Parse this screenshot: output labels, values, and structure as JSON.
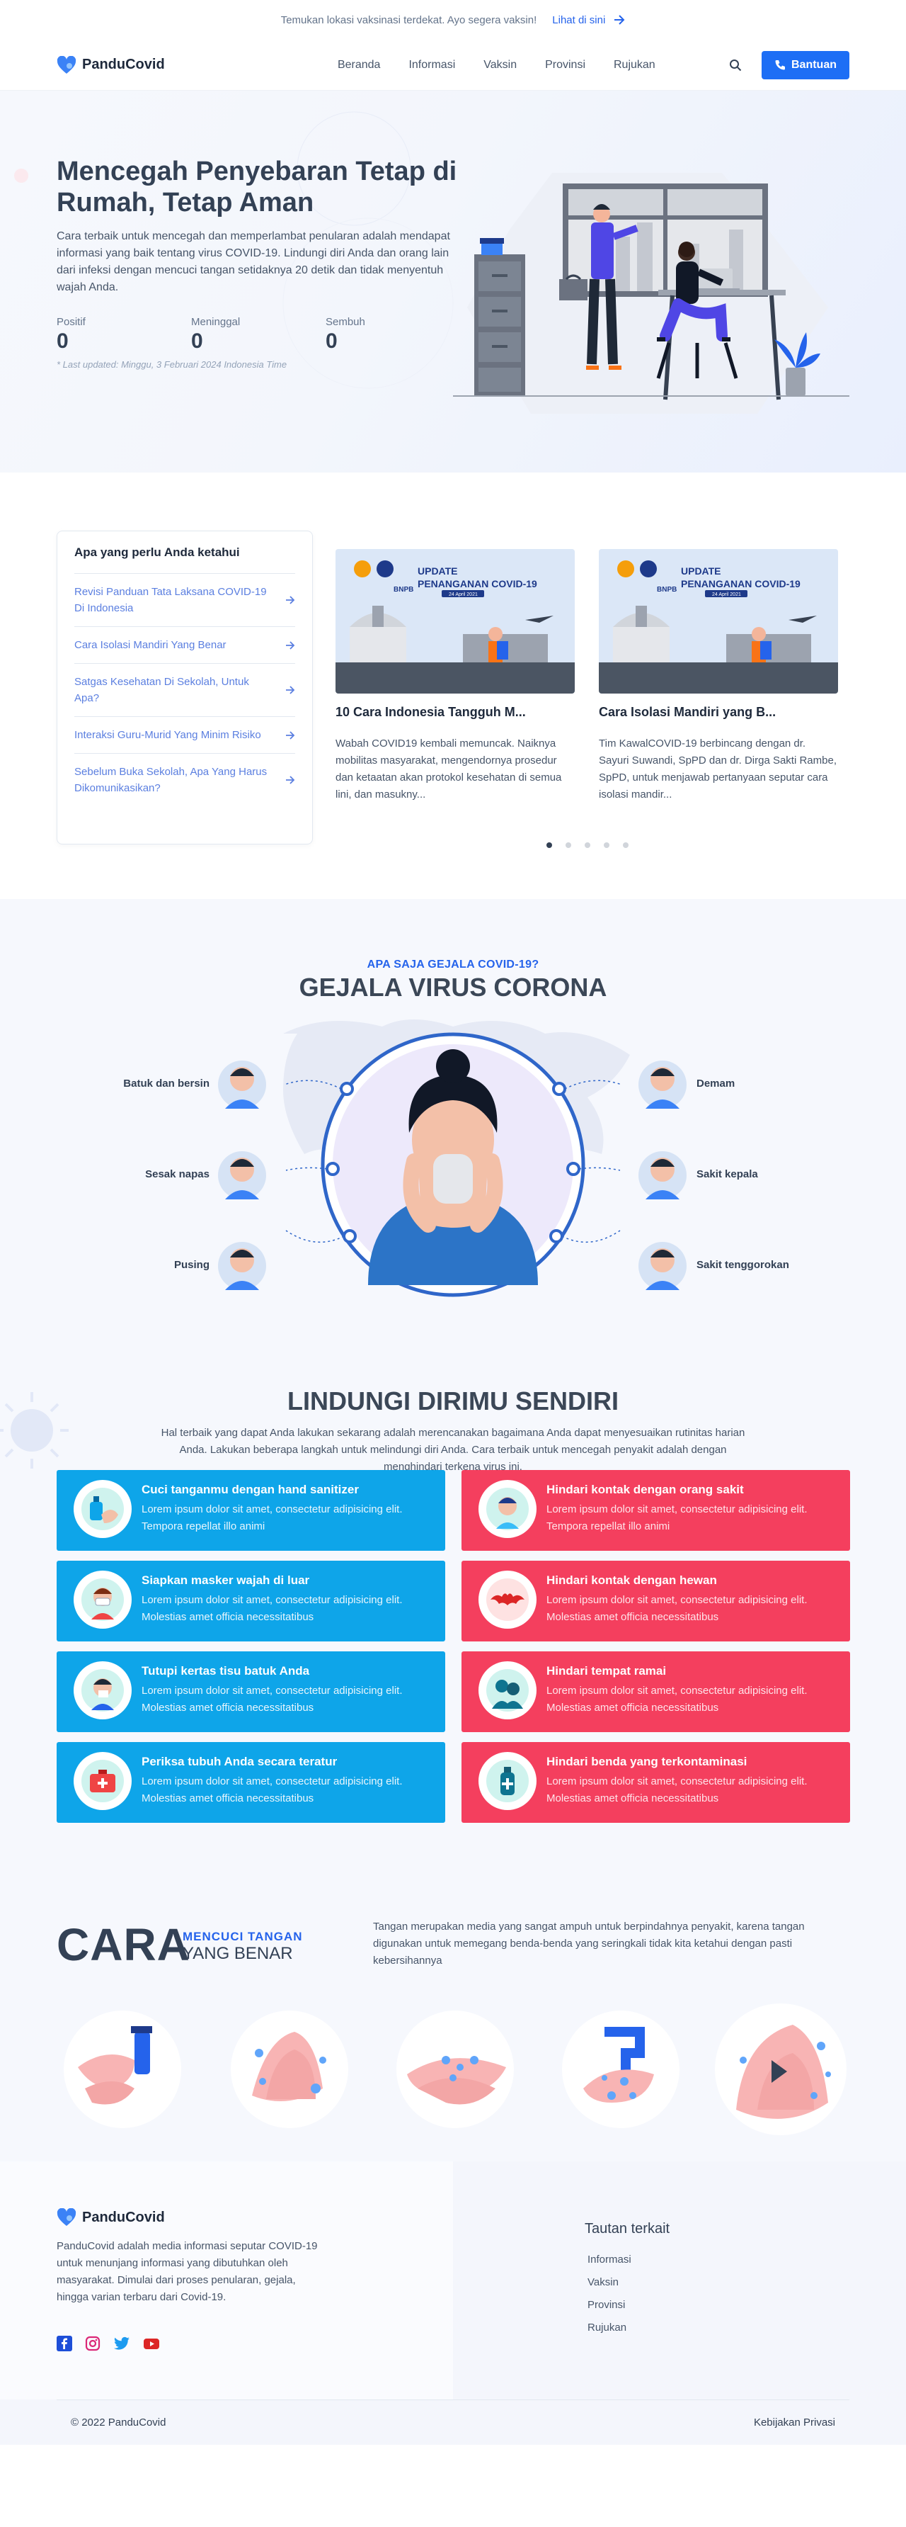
{
  "announcement": {
    "text": "Temukan lokasi vaksinasi terdekat. Ayo segera vaksin!",
    "link": "Lihat di sini"
  },
  "nav": {
    "brand": "PanduCovid",
    "links": [
      "Beranda",
      "Informasi",
      "Vaksin",
      "Provinsi",
      "Rujukan"
    ],
    "help_label": "Bantuan"
  },
  "hero": {
    "title": "Mencegah Penyebaran Tetap di Rumah, Tetap Aman",
    "lead": "Cara terbaik untuk mencegah dan memperlambat penularan adalah mendapat informasi yang baik tentang virus COVID-19. Lindungi diri Anda dan orang lain dari infeksi dengan mencuci tangan setidaknya 20 detik dan tidak menyentuh wajah Anda.",
    "stats": [
      {
        "label": "Positif",
        "value": "0"
      },
      {
        "label": "Meninggal",
        "value": "0"
      },
      {
        "label": "Sembuh",
        "value": "0"
      }
    ],
    "updated": "* Last updated: Minggu, 3 Februari 2024 Indonesia Time"
  },
  "faq": {
    "title": "Apa yang perlu Anda ketahui",
    "items": [
      "Revisi Panduan Tata Laksana COVID-19 Di Indonesia",
      "Cara Isolasi Mandiri Yang Benar",
      "Satgas Kesehatan Di Sekolah, Untuk Apa?",
      "Interaksi Guru-Murid Yang Minim Risiko",
      "Sebelum Buka Sekolah, Apa Yang Harus Dikomunikasikan?"
    ]
  },
  "news": [
    {
      "banner_title": "UPDATE PENANGANAN COVID-19",
      "banner_date": "24 April 2021",
      "agency": "BNPB",
      "title": "10 Cara Indonesia Tangguh M...",
      "body": "Wabah COVID19 kembali memuncak. Naiknya mobilitas masyarakat, mengendornya prosedur dan ketaatan akan protokol kesehatan di semua lini, dan masukny..."
    },
    {
      "banner_title": "UPDATE PENANGANAN COVID-19",
      "banner_date": "24 April 2021",
      "agency": "BNPB",
      "title": "Cara Isolasi Mandiri yang B...",
      "body": "Tim KawalCOVID-19 berbincang dengan dr. Sayuri Suwandi, SpPD dan dr. Dirga Sakti Rambe, SpPD, untuk menjawab pertanyaan seputar cara isolasi mandir..."
    }
  ],
  "carousel": {
    "active_index": 0,
    "count": 5
  },
  "gejala": {
    "subtitle": "APA SAJA GEJALA COVID-19?",
    "title": "GEJALA VIRUS CORONA",
    "left": [
      "Batuk dan bersin",
      "Sesak napas",
      "Pusing"
    ],
    "right": [
      "Demam",
      "Sakit kepala",
      "Sakit tenggorokan"
    ]
  },
  "lindungi": {
    "title": "LINDUNGI DIRIMU SENDIRI",
    "desc": "Hal terbaik yang dapat Anda lakukan sekarang adalah merencanakan bagaimana Anda dapat menyesuaikan rutinitas harian Anda. Lakukan beberapa langkah untuk melindungi diri Anda. Cara terbaik untuk mencegah penyakit adalah dengan menghindari terkena virus ini.",
    "dos": [
      {
        "title": "Cuci tanganmu dengan hand sanitizer",
        "body": "Lorem ipsum dolor sit amet, consectetur adipisicing elit. Tempora repellat illo animi",
        "icon": "hand-sanitizer-icon"
      },
      {
        "title": "Siapkan masker wajah di luar",
        "body": "Lorem ipsum dolor sit amet, consectetur adipisicing elit. Molestias amet officia necessitatibus",
        "icon": "face-mask-icon"
      },
      {
        "title": "Tutupi kertas tisu batuk Anda",
        "body": "Lorem ipsum dolor sit amet, consectetur adipisicing elit. Molestias amet officia necessitatibus",
        "icon": "tissue-cough-icon"
      },
      {
        "title": "Periksa tubuh Anda secara teratur",
        "body": "Lorem ipsum dolor sit amet, consectetur adipisicing elit. Molestias amet officia necessitatibus",
        "icon": "first-aid-kit-icon"
      }
    ],
    "donts": [
      {
        "title": "Hindari kontak dengan orang sakit",
        "body": "Lorem ipsum dolor sit amet, consectetur adipisicing elit. Tempora repellat illo animi",
        "icon": "sick-person-icon"
      },
      {
        "title": "Hindari kontak dengan hewan",
        "body": "Lorem ipsum dolor sit amet, consectetur adipisicing elit. Molestias amet officia necessitatibus",
        "icon": "bat-icon"
      },
      {
        "title": "Hindari tempat ramai",
        "body": "Lorem ipsum dolor sit amet, consectetur adipisicing elit. Molestias amet officia necessitatibus",
        "icon": "crowd-icon"
      },
      {
        "title": "Hindari benda yang terkontaminasi",
        "body": "Lorem ipsum dolor sit amet, consectetur adipisicing elit. Molestias amet officia necessitatibus",
        "icon": "contaminated-bottle-icon"
      }
    ]
  },
  "cara": {
    "big": "CARA",
    "sub1": "MENCUCI TANGAN",
    "sub2": "YANG BENAR",
    "desc": "Tangan merupakan media yang sangat ampuh untuk berpindahnya penyakit, karena tangan digunakan untuk memegang benda-benda yang seringkali tidak kita ketahui dengan pasti kebersihannya"
  },
  "footer": {
    "brand": "PanduCovid",
    "desc": "PanduCovid adalah media informasi seputar COVID-19 untuk menunjang informasi yang dibutuhkan oleh masyarakat. Dimulai dari proses penularan, gejala, hingga varian terbaru dari Covid-19.",
    "links_title": "Tautan terkait",
    "links": [
      "Informasi",
      "Vaksin",
      "Provinsi",
      "Rujukan"
    ],
    "copyright": "© 2022 PanduCovid",
    "privacy": "Kebijakan Privasi"
  },
  "colors": {
    "primary": "#1d6ef5",
    "tip_blue": "#0ea5e9",
    "tip_red": "#f43f5e",
    "heading": "#334155"
  }
}
